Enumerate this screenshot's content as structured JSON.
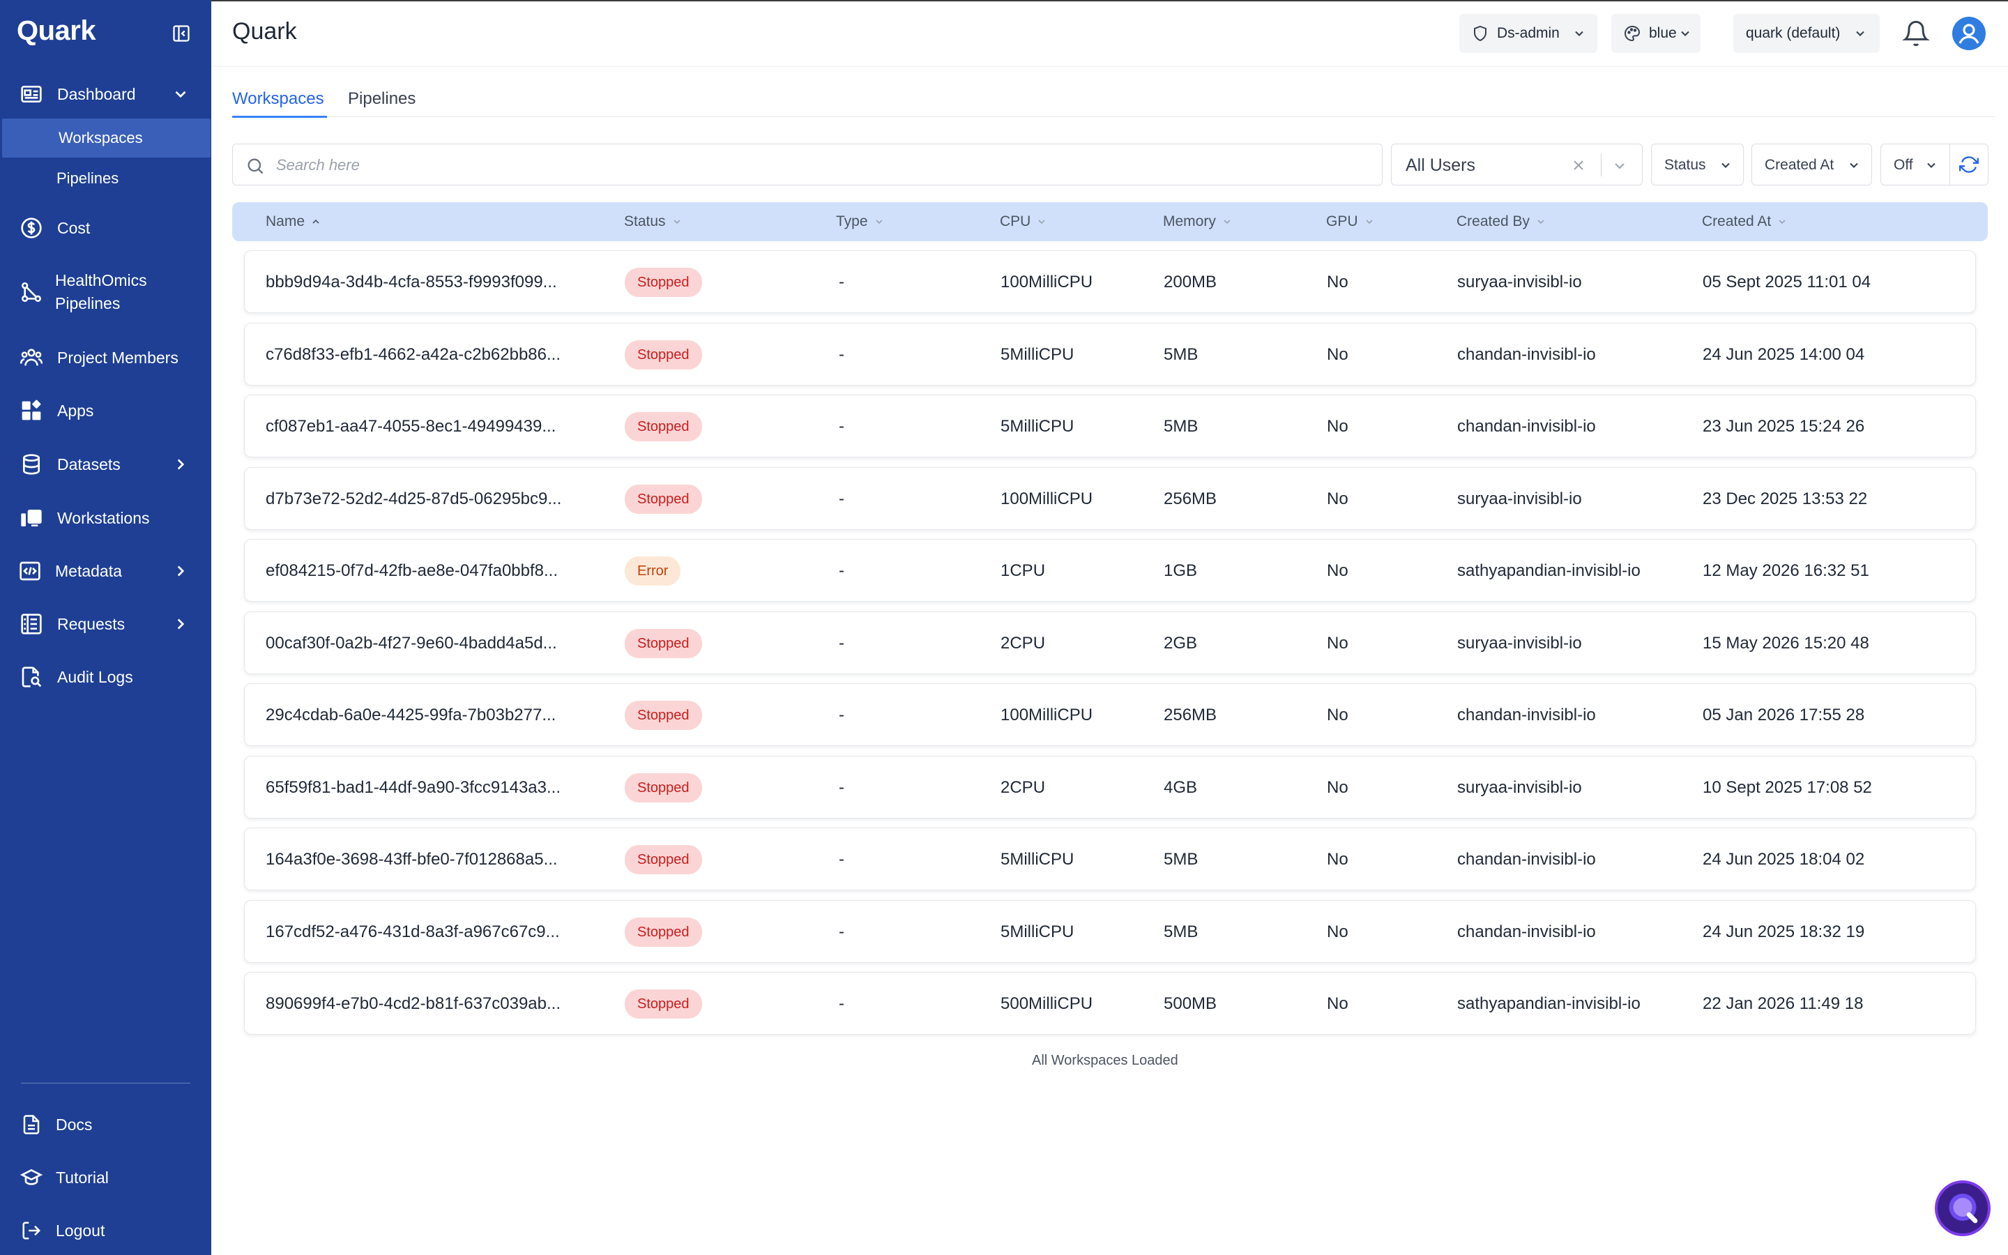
{
  "app": {
    "brand": "Quark",
    "page_title": "Quark"
  },
  "sidebar": {
    "items": [
      {
        "label": "Dashboard",
        "icon": "dashboard-icon",
        "expanded": true
      },
      {
        "label": "Cost",
        "icon": "dollar-icon"
      },
      {
        "label": "HealthOmics\nPipelines",
        "icon": "pipeline-nodes-icon"
      },
      {
        "label": "Project Members",
        "icon": "users-icon"
      },
      {
        "label": "Apps",
        "icon": "apps-icon"
      },
      {
        "label": "Datasets",
        "icon": "database-icon",
        "has_children": true
      },
      {
        "label": "Workstations",
        "icon": "workstation-icon"
      },
      {
        "label": "Metadata",
        "icon": "code-icon",
        "has_children": true
      },
      {
        "label": "Requests",
        "icon": "requests-icon",
        "has_children": true
      },
      {
        "label": "Audit Logs",
        "icon": "audit-search-icon"
      }
    ],
    "sub_items": [
      {
        "label": "Workspaces",
        "active": true
      },
      {
        "label": "Pipelines",
        "active": false
      }
    ],
    "footer": [
      {
        "label": "Docs",
        "icon": "document-icon"
      },
      {
        "label": "Tutorial",
        "icon": "graduation-cap-icon"
      },
      {
        "label": "Logout",
        "icon": "logout-icon"
      }
    ]
  },
  "header": {
    "role": "Ds-admin",
    "theme": "blue",
    "project": "quark (default)"
  },
  "tabs": [
    {
      "label": "Workspaces",
      "active": true
    },
    {
      "label": "Pipelines",
      "active": false
    }
  ],
  "filters": {
    "search_placeholder": "Search here",
    "user_filter": "All Users",
    "status": "Status",
    "created_at": "Created At",
    "auto_refresh": "Off"
  },
  "table": {
    "columns": [
      "Name",
      "Status",
      "Type",
      "CPU",
      "Memory",
      "GPU",
      "Created By",
      "Created At"
    ],
    "rows": [
      {
        "name": "bbb9d94a-3d4b-4cfa-8553-f9993f099...",
        "status": "Stopped",
        "type": "-",
        "cpu": "100MilliCPU",
        "memory": "200MB",
        "gpu": "No",
        "created_by": "suryaa-invisibl-io",
        "created_at": "05 Sept 2025 11:01 04"
      },
      {
        "name": "c76d8f33-efb1-4662-a42a-c2b62bb86...",
        "status": "Stopped",
        "type": "-",
        "cpu": "5MilliCPU",
        "memory": "5MB",
        "gpu": "No",
        "created_by": "chandan-invisibl-io",
        "created_at": "24 Jun 2025 14:00 04"
      },
      {
        "name": "cf087eb1-aa47-4055-8ec1-49499439...",
        "status": "Stopped",
        "type": "-",
        "cpu": "5MilliCPU",
        "memory": "5MB",
        "gpu": "No",
        "created_by": "chandan-invisibl-io",
        "created_at": "23 Jun 2025 15:24 26"
      },
      {
        "name": "d7b73e72-52d2-4d25-87d5-06295bc9...",
        "status": "Stopped",
        "type": "-",
        "cpu": "100MilliCPU",
        "memory": "256MB",
        "gpu": "No",
        "created_by": "suryaa-invisibl-io",
        "created_at": "23 Dec 2025 13:53 22"
      },
      {
        "name": "ef084215-0f7d-42fb-ae8e-047fa0bbf8...",
        "status": "Error",
        "type": "-",
        "cpu": "1CPU",
        "memory": "1GB",
        "gpu": "No",
        "created_by": "sathyapandian-invisibl-io",
        "created_at": "12 May 2026 16:32 51"
      },
      {
        "name": "00caf30f-0a2b-4f27-9e60-4badd4a5d...",
        "status": "Stopped",
        "type": "-",
        "cpu": "2CPU",
        "memory": "2GB",
        "gpu": "No",
        "created_by": "suryaa-invisibl-io",
        "created_at": "15 May 2026 15:20 48"
      },
      {
        "name": "29c4cdab-6a0e-4425-99fa-7b03b277...",
        "status": "Stopped",
        "type": "-",
        "cpu": "100MilliCPU",
        "memory": "256MB",
        "gpu": "No",
        "created_by": "chandan-invisibl-io",
        "created_at": "05 Jan 2026 17:55 28"
      },
      {
        "name": "65f59f81-bad1-44df-9a90-3fcc9143a3...",
        "status": "Stopped",
        "type": "-",
        "cpu": "2CPU",
        "memory": "4GB",
        "gpu": "No",
        "created_by": "suryaa-invisibl-io",
        "created_at": "10 Sept 2025 17:08 52"
      },
      {
        "name": "164a3f0e-3698-43ff-bfe0-7f012868a5...",
        "status": "Stopped",
        "type": "-",
        "cpu": "5MilliCPU",
        "memory": "5MB",
        "gpu": "No",
        "created_by": "chandan-invisibl-io",
        "created_at": "24 Jun 2025 18:04 02"
      },
      {
        "name": "167cdf52-a476-431d-8a3f-a967c67c9...",
        "status": "Stopped",
        "type": "-",
        "cpu": "5MilliCPU",
        "memory": "5MB",
        "gpu": "No",
        "created_by": "chandan-invisibl-io",
        "created_at": "24 Jun 2025 18:32 19"
      },
      {
        "name": "890699f4-e7b0-4cd2-b81f-637c039ab...",
        "status": "Stopped",
        "type": "-",
        "cpu": "500MilliCPU",
        "memory": "500MB",
        "gpu": "No",
        "created_by": "sathyapandian-invisibl-io",
        "created_at": "22 Jan 2026 11:49 18"
      }
    ],
    "footer_text": "All Workspaces Loaded"
  },
  "colors": {
    "sidebar": "#1e3f94",
    "accent": "#3b82f6",
    "header_row": "#d1e0fa",
    "stopped_bg": "#fbd5d5",
    "error_bg": "#fde8d7"
  }
}
